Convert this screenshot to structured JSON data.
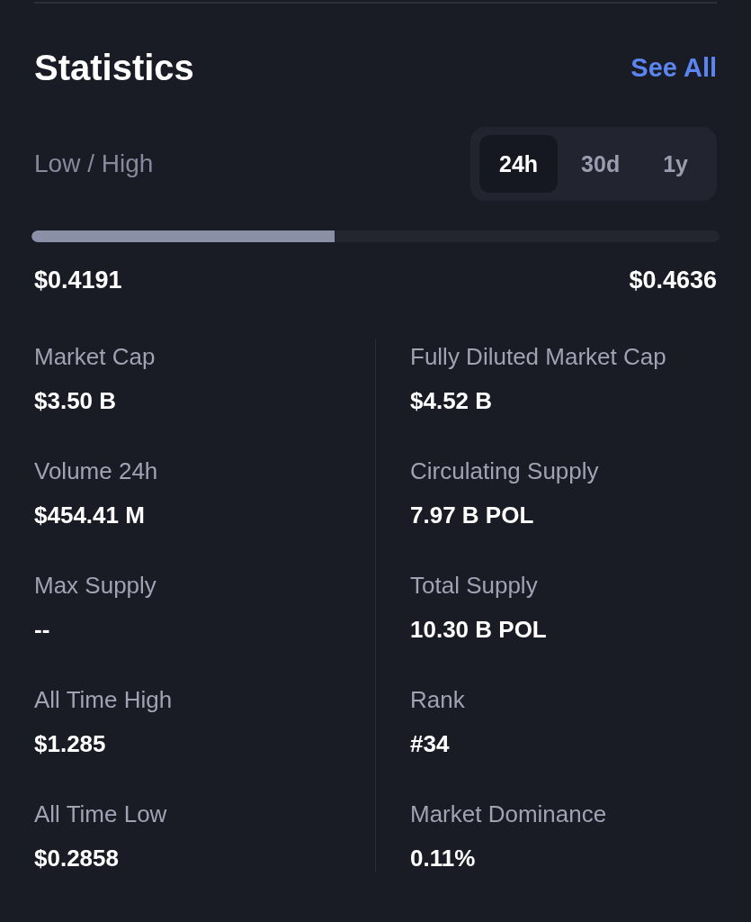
{
  "header": {
    "title": "Statistics",
    "link": "See All"
  },
  "range": {
    "label": "Low / High",
    "periods": [
      {
        "label": "24h",
        "selected": true
      },
      {
        "label": "30d",
        "selected": false
      },
      {
        "label": "1y",
        "selected": false
      }
    ],
    "level": 0.44,
    "low": "$0.4191",
    "high": "$0.4636"
  },
  "stats": {
    "left": [
      {
        "label": "Market Cap",
        "value": "$3.50 B"
      },
      {
        "label": "Volume 24h",
        "value": "$454.41 M"
      },
      {
        "label": "Max Supply",
        "value": "--"
      },
      {
        "label": "All Time High",
        "value": "$1.285"
      },
      {
        "label": "All Time Low",
        "value": "$0.2858"
      }
    ],
    "right": [
      {
        "label": "Fully Diluted Market Cap",
        "value": "$4.52 B"
      },
      {
        "label": "Circulating Supply",
        "value": "7.97 B POL"
      },
      {
        "label": "Total Supply",
        "value": "10.30 B POL"
      },
      {
        "label": "Rank",
        "value": "#34"
      },
      {
        "label": "Market Dominance",
        "value": "0.11%"
      }
    ]
  }
}
